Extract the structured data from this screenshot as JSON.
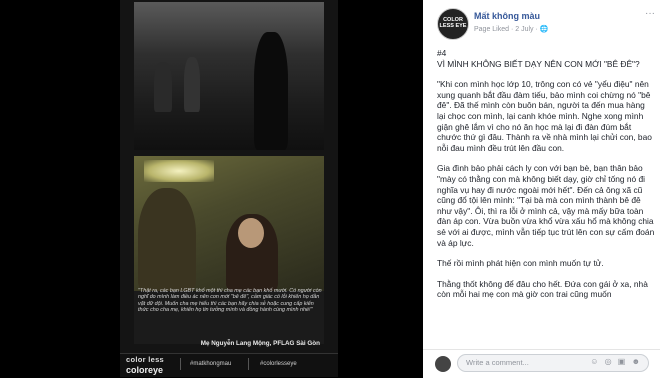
{
  "poster": {
    "quote": "\"Thật ra, các bạn LGBT khổ một thì cha mẹ các bạn khổ mười. Có người còn nghĩ do mình làm điều ác nên con mới \"bê đê\", cảm giác có lỗi khiến họ dằn vặt dữ dội. Muốn cha mẹ hiểu thì các bạn hãy chia sẻ hoặc cung cấp kiến thức cho cha mẹ, khiến họ tin tưởng mình và đồng hành cùng mình nhé!\"",
    "author": "Mẹ Nguyễn Lang Mộng, PFLAG Sài Gòn",
    "logo_top": "color less",
    "logo_bottom": "coloreye",
    "tags": [
      "#matkhongmau",
      "#colorlesseye"
    ]
  },
  "post": {
    "page_name": "Mất không màu",
    "meta": "Page Liked · 2 July · ",
    "avatar_text": "COLOR LESS EYE",
    "more": "···",
    "paragraphs": [
      "#4\nVÌ MÌNH KHÔNG BIẾT DẠY NÊN CON MỚI \"BÊ ĐÊ\"?",
      "\"Khi con mình học lớp 10, trông con có vẻ \"yểu điệu\" nên xung quanh bắt đầu đàm tiếu, bảo mình coi chừng nó \"bê đê\". Đã thế mình còn buôn bán, người ta đến mua hàng lại chọc con mình, lại canh khóe mình. Nghe xong mình giận ghê lắm vì cho nó ăn học mà lại đi đàn đúm bắt chước thứ gì đâu. Thành ra về nhà mình lại chửi con, bao nỗi đau mình đều trút lên đầu con.",
      "Gia đình bảo phải cách ly con với bạn bè, bạn thân bảo \"mày có thằng con mà không biết dạy, giờ chỉ tống nó đi nghĩa vụ hay đi nước ngoài mới hết\". Đến cả ông xã cũ cũng đổ tội lên mình: \"Tại bà mà con mình thành bê đê như vậy\". Ôi, thì ra lỗi ở mình cả, vậy mà mấy bữa toàn đàn áp con. Vừa buồn vừa khổ vừa xấu hổ mà không chia sẻ với ai được, mình vẫn tiếp tục trút lên con sự cấm đoán và áp lực.",
      "Thế rồi mình phát hiện con mình muốn tự tử.",
      "Thằng thốt không để đâu cho hết. Đứa con gái ở xa, nhà còn mỗi hai mẹ con mà giờ con trai cũng muốn"
    ],
    "comment_placeholder": "Write a comment...",
    "comment_icons": "☺ ◎ ▣ ☻"
  },
  "colors": {
    "link": "#365899",
    "meta": "#90949c",
    "text": "#1d2129",
    "poster_bg": "#141414"
  }
}
